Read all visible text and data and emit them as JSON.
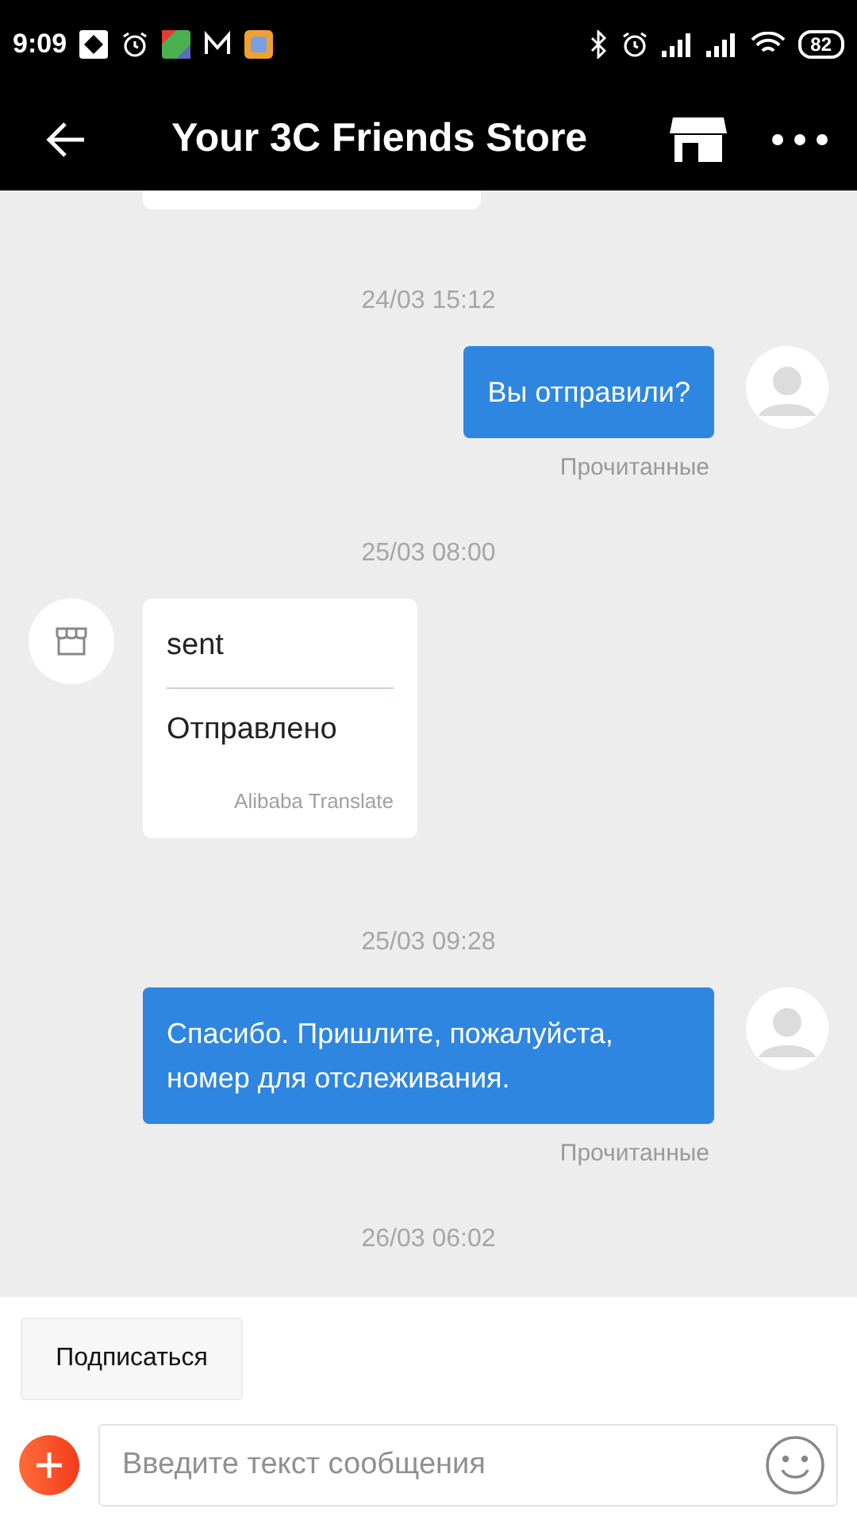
{
  "status_bar": {
    "time": "9:09",
    "battery": "82"
  },
  "header": {
    "title": "Your 3C Friends Store"
  },
  "messages": [
    {
      "kind": "time",
      "text": "24/03 15:12"
    },
    {
      "kind": "outgoing",
      "text": "Вы отправили?",
      "status": "Прочитанные"
    },
    {
      "kind": "time",
      "text": "25/03 08:00"
    },
    {
      "kind": "incoming",
      "original": "sent",
      "translation": "Отправлено",
      "translator": "Alibaba Translate"
    },
    {
      "kind": "time",
      "text": "25/03 09:28"
    },
    {
      "kind": "outgoing",
      "text": "Спасибо. Пришлите, пожалуйста, номер для отслеживания.",
      "status": "Прочитанные"
    },
    {
      "kind": "time",
      "text": "26/03 06:02"
    }
  ],
  "subscribe_button": "Подписаться",
  "composer": {
    "placeholder": "Введите текст сообщения"
  }
}
